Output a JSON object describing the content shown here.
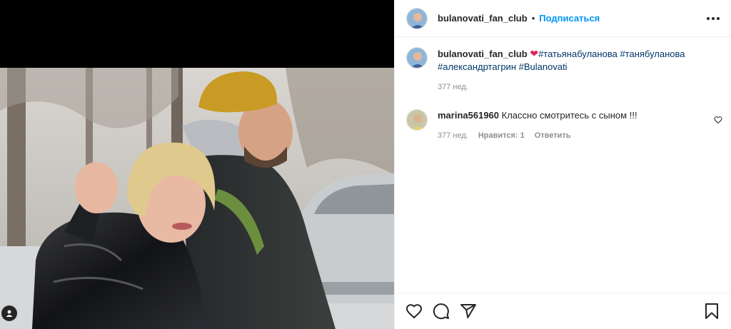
{
  "post": {
    "username": "bulanovati_fan_club",
    "separator": "•",
    "follow_label": "Подписаться",
    "caption": {
      "username": "bulanovati_fan_club",
      "emoji": "❤",
      "hashtags": [
        "#татьянабуланова",
        "#танябуланова",
        "#александртагрин",
        "#Bulanovati"
      ],
      "time": "377 нед."
    }
  },
  "comments": [
    {
      "username": "marina561960",
      "text": "Классно смотритесь с сыном !!!",
      "time": "377 нед.",
      "likes_label": "Нравится: 1",
      "reply_label": "Ответить"
    }
  ],
  "icons": {
    "more": "more-horizontal-icon",
    "like": "heart-icon",
    "comment": "comment-icon",
    "share": "share-icon",
    "save": "bookmark-icon",
    "tag": "user-tag-icon"
  },
  "colors": {
    "link": "#00376b",
    "follow": "#0095f6",
    "muted": "#8e8e8e",
    "text": "#262626"
  }
}
